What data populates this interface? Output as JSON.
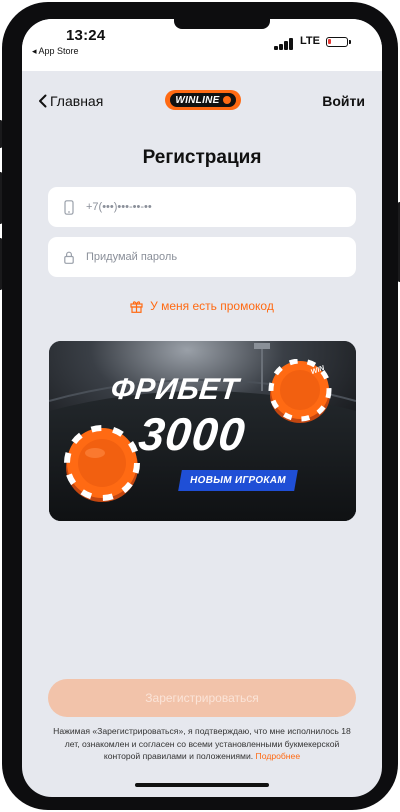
{
  "status_bar": {
    "time": "13:24",
    "back_to_app": "◂ App Store",
    "network": "LTE",
    "battery_level": 0.15,
    "battery_color": "#e53935"
  },
  "nav": {
    "back_label": "Главная",
    "back_icon": "chevron-left-icon",
    "logo_text": "WINLINE",
    "login_label": "Войти"
  },
  "page": {
    "title": "Регистрация"
  },
  "form": {
    "phone": {
      "icon": "phone-icon",
      "placeholder": "+7(•••)•••-••-••",
      "value": ""
    },
    "password": {
      "icon": "lock-icon",
      "placeholder": "Придумай пароль",
      "value": ""
    },
    "promo_label": "У меня есть промокод",
    "promo_icon": "gift-icon",
    "submit_label": "Зарегистрироваться"
  },
  "banner": {
    "line1": "ФРИБЕТ",
    "line2": "3000",
    "badge": "НОВЫМ ИГРОКАМ",
    "chip_text": "WIN"
  },
  "legal": {
    "text": "Нажимая «Зарегистрироваться», я подтверждаю, что мне исполнилось 18 лет, ознакомлен и согласен со всеми установленными букмекерской конторой правилами и положениями.",
    "more_link": "Подробнее"
  },
  "colors": {
    "accent": "#ff6a13",
    "screen_bg": "#e6e8ee",
    "button_disabled": "#f2c3aa",
    "badge_blue": "#1f4fd6"
  }
}
